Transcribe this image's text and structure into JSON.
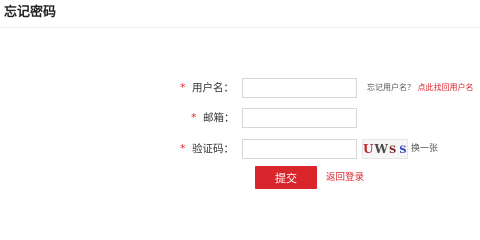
{
  "page": {
    "title": "忘记密码"
  },
  "form": {
    "required_mark": "*",
    "username": {
      "label": "用户名：",
      "value": "",
      "placeholder": ""
    },
    "username_hint": {
      "prefix": "忘记用户名？",
      "link": "点此找回用户名"
    },
    "email": {
      "label": "邮箱：",
      "value": "",
      "placeholder": ""
    },
    "captcha": {
      "label": "验证码：",
      "value": "",
      "placeholder": "",
      "chars": [
        "U",
        "W",
        "S",
        "S"
      ]
    },
    "refresh_label": "换一张",
    "submit_label": "提交",
    "back_label": "返回登录"
  },
  "colors": {
    "accent": "#d9262c",
    "required": "#e02525"
  }
}
